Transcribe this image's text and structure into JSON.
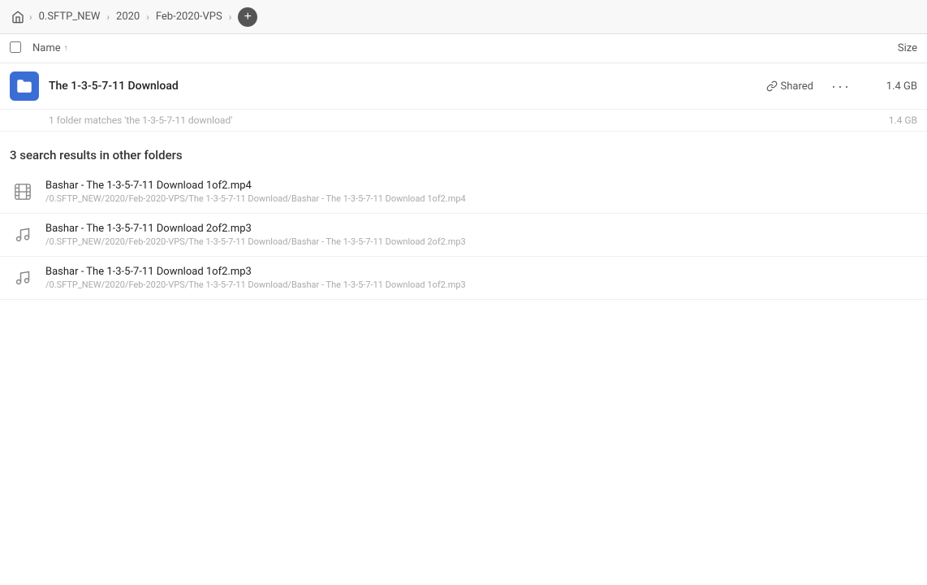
{
  "header": {
    "home_icon": "⌂",
    "breadcrumb": [
      {
        "label": "0.SFTP_NEW"
      },
      {
        "label": "2020"
      },
      {
        "label": "Feb-2020-VPS"
      }
    ],
    "add_label": "+"
  },
  "columns": {
    "select_all_label": "",
    "name_label": "Name",
    "sort_indicator": "↑",
    "size_label": "Size"
  },
  "main_result": {
    "name": "The 1-3-5-7-11 Download",
    "shared_label": "Shared",
    "more_label": "···",
    "size": "1.4 GB",
    "match_hint": "1 folder matches 'the 1-3-5-7-11 download'",
    "match_size": "1.4 GB"
  },
  "other_results": {
    "section_title": "3 search results in other folders",
    "items": [
      {
        "type": "video",
        "name": "Bashar - The 1-3-5-7-11 Download 1of2.mp4",
        "path": "/0.SFTP_NEW/2020/Feb-2020-VPS/The 1-3-5-7-11 Download/Bashar - The 1-3-5-7-11 Download 1of2.mp4"
      },
      {
        "type": "audio",
        "name": "Bashar - The 1-3-5-7-11 Download 2of2.mp3",
        "path": "/0.SFTP_NEW/2020/Feb-2020-VPS/The 1-3-5-7-11 Download/Bashar - The 1-3-5-7-11 Download 2of2.mp3"
      },
      {
        "type": "audio",
        "name": "Bashar - The 1-3-5-7-11 Download 1of2.mp3",
        "path": "/0.SFTP_NEW/2020/Feb-2020-VPS/The 1-3-5-7-11 Download/Bashar - The 1-3-5-7-11 Download 1of2.mp3"
      }
    ]
  },
  "icons": {
    "home": "🏠",
    "folder": "📁",
    "link": "🔗",
    "video": "🎬",
    "audio": "♪"
  }
}
